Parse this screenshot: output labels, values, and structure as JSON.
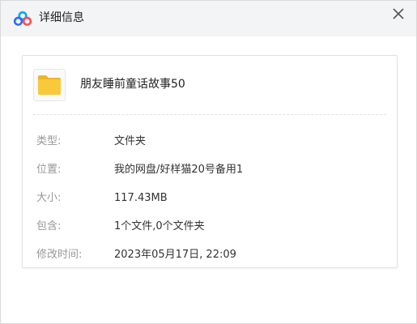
{
  "window": {
    "title": "详细信息",
    "logo_icon": "baidu-netdisk-logo-icon",
    "close_icon": "close-icon"
  },
  "item": {
    "icon": "folder-icon",
    "icon_color": "#f8c93a",
    "name": "朋友睡前童话故事50"
  },
  "details": [
    {
      "label": "类型:",
      "value": "文件夹"
    },
    {
      "label": "位置:",
      "value": "我的网盘/好样猫20号备用1"
    },
    {
      "label": "大小:",
      "value": "117.43MB"
    },
    {
      "label": "包含:",
      "value": "1个文件,0个文件夹"
    },
    {
      "label": "修改时间:",
      "value": "2023年05月17日, 22:09"
    }
  ]
}
